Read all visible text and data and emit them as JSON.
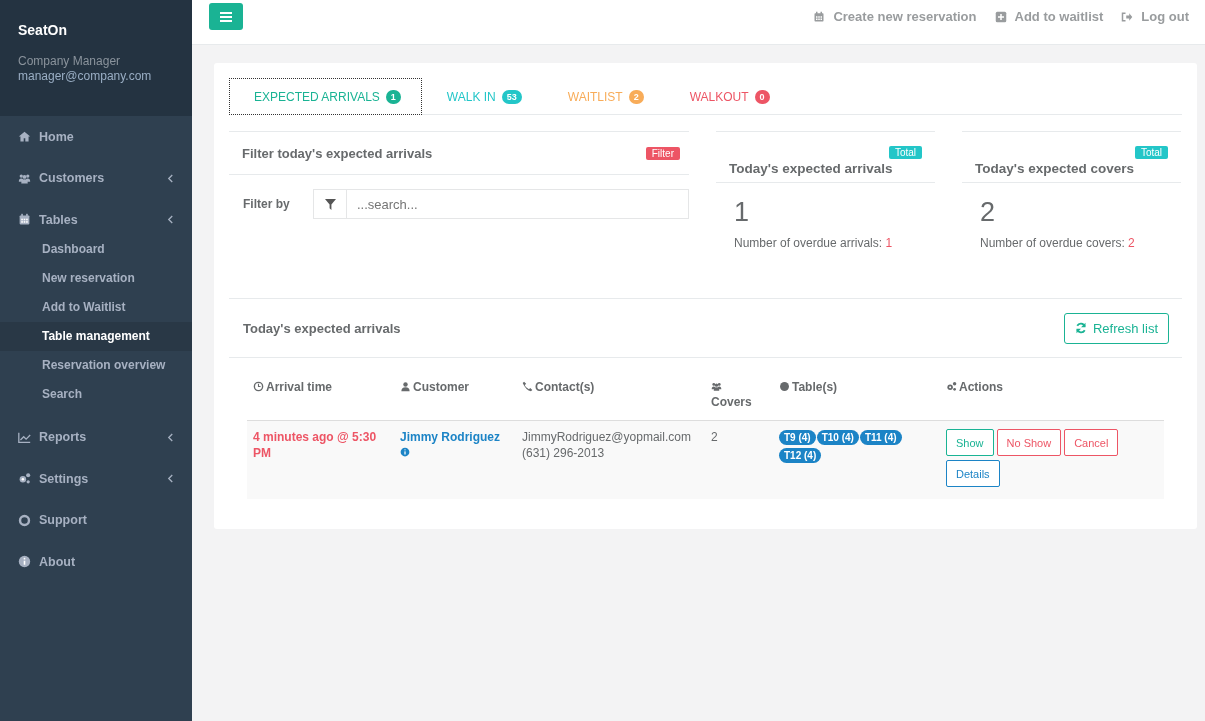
{
  "sidebar": {
    "brand": "SeatOn",
    "role": "Company Manager",
    "email": "manager@company.com",
    "items": [
      {
        "label": "Home",
        "submenu": false
      },
      {
        "label": "Customers",
        "submenu": true
      },
      {
        "label": "Tables",
        "submenu": true,
        "children": [
          {
            "label": "Dashboard",
            "selected": false
          },
          {
            "label": "New reservation",
            "selected": false
          },
          {
            "label": "Add to Waitlist",
            "selected": false
          },
          {
            "label": "Table management",
            "selected": true
          },
          {
            "label": "Reservation overview",
            "selected": false
          },
          {
            "label": "Search",
            "selected": false
          }
        ]
      },
      {
        "label": "Reports",
        "submenu": true
      },
      {
        "label": "Settings",
        "submenu": true
      },
      {
        "label": "Support",
        "submenu": false
      },
      {
        "label": "About",
        "submenu": false
      }
    ]
  },
  "topbar": {
    "links": [
      "Create new reservation",
      "Add to waitlist",
      "Log out"
    ]
  },
  "tabs": [
    {
      "label": "EXPECTED ARRIVALS",
      "count": "1",
      "color": "#1ab394",
      "selected": true
    },
    {
      "label": "WALK IN",
      "count": "53",
      "color": "#23c6c8",
      "selected": false
    },
    {
      "label": "WAITLIST",
      "count": "2",
      "color": "#f8ac59",
      "selected": false
    },
    {
      "label": "WALKOUT",
      "count": "0",
      "color": "#ed5565",
      "selected": false
    }
  ],
  "filter": {
    "title": "Filter today's expected arrivals",
    "badge": "Filter",
    "label": "Filter by",
    "placeholder": "...search..."
  },
  "stats": [
    {
      "title": "Today's expected arrivals",
      "badge": "Total",
      "value": "1",
      "note": "Number of overdue arrivals:",
      "overdue": "1"
    },
    {
      "title": "Today's expected covers",
      "badge": "Total",
      "value": "2",
      "note": "Number of overdue covers:",
      "overdue": "2"
    }
  ],
  "list": {
    "title": "Today's expected arrivals",
    "refresh": "Refresh list",
    "columns": [
      "Arrival time",
      "Customer",
      "Contact(s)",
      "Covers",
      "Table(s)",
      "Actions"
    ],
    "rows": [
      {
        "arrival": "4 minutes ago @ 5:30 PM",
        "customer": "Jimmy Rodriguez",
        "email": "JimmyRodriguez@yopmail.com",
        "phone": "(631) 296-2013",
        "covers": "2",
        "tables": [
          "T9 (4)",
          "T10 (4)",
          "T11 (4)",
          "T12 (4)"
        ],
        "actions": [
          {
            "label": "Show",
            "kind": "success"
          },
          {
            "label": "No Show",
            "kind": "danger"
          },
          {
            "label": "Cancel",
            "kind": "danger"
          },
          {
            "label": "Details",
            "kind": "primary"
          }
        ]
      }
    ]
  }
}
